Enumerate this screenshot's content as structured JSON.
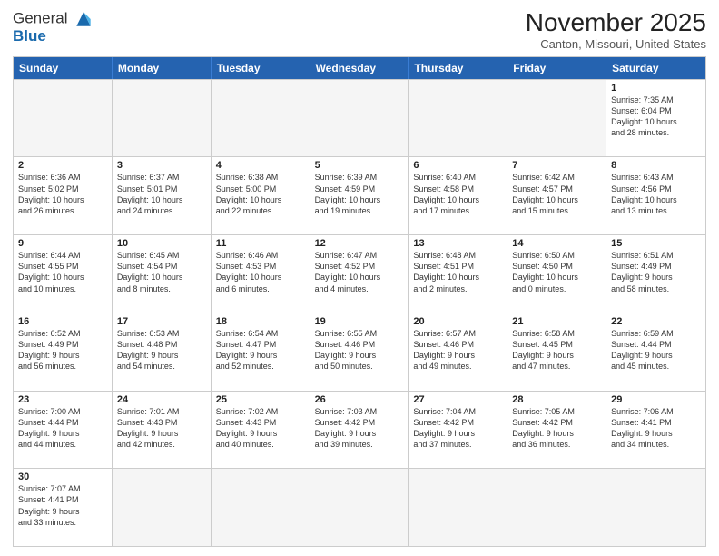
{
  "header": {
    "logo_line1": "General",
    "logo_line2": "Blue",
    "month": "November 2025",
    "location": "Canton, Missouri, United States"
  },
  "days_of_week": [
    "Sunday",
    "Monday",
    "Tuesday",
    "Wednesday",
    "Thursday",
    "Friday",
    "Saturday"
  ],
  "weeks": [
    [
      {
        "num": "",
        "info": "",
        "empty": true
      },
      {
        "num": "",
        "info": "",
        "empty": true
      },
      {
        "num": "",
        "info": "",
        "empty": true
      },
      {
        "num": "",
        "info": "",
        "empty": true
      },
      {
        "num": "",
        "info": "",
        "empty": true
      },
      {
        "num": "",
        "info": "",
        "empty": true
      },
      {
        "num": "1",
        "info": "Sunrise: 7:35 AM\nSunset: 6:04 PM\nDaylight: 10 hours\nand 28 minutes.",
        "empty": false
      }
    ],
    [
      {
        "num": "2",
        "info": "Sunrise: 6:36 AM\nSunset: 5:02 PM\nDaylight: 10 hours\nand 26 minutes.",
        "empty": false
      },
      {
        "num": "3",
        "info": "Sunrise: 6:37 AM\nSunset: 5:01 PM\nDaylight: 10 hours\nand 24 minutes.",
        "empty": false
      },
      {
        "num": "4",
        "info": "Sunrise: 6:38 AM\nSunset: 5:00 PM\nDaylight: 10 hours\nand 22 minutes.",
        "empty": false
      },
      {
        "num": "5",
        "info": "Sunrise: 6:39 AM\nSunset: 4:59 PM\nDaylight: 10 hours\nand 19 minutes.",
        "empty": false
      },
      {
        "num": "6",
        "info": "Sunrise: 6:40 AM\nSunset: 4:58 PM\nDaylight: 10 hours\nand 17 minutes.",
        "empty": false
      },
      {
        "num": "7",
        "info": "Sunrise: 6:42 AM\nSunset: 4:57 PM\nDaylight: 10 hours\nand 15 minutes.",
        "empty": false
      },
      {
        "num": "8",
        "info": "Sunrise: 6:43 AM\nSunset: 4:56 PM\nDaylight: 10 hours\nand 13 minutes.",
        "empty": false
      }
    ],
    [
      {
        "num": "9",
        "info": "Sunrise: 6:44 AM\nSunset: 4:55 PM\nDaylight: 10 hours\nand 10 minutes.",
        "empty": false
      },
      {
        "num": "10",
        "info": "Sunrise: 6:45 AM\nSunset: 4:54 PM\nDaylight: 10 hours\nand 8 minutes.",
        "empty": false
      },
      {
        "num": "11",
        "info": "Sunrise: 6:46 AM\nSunset: 4:53 PM\nDaylight: 10 hours\nand 6 minutes.",
        "empty": false
      },
      {
        "num": "12",
        "info": "Sunrise: 6:47 AM\nSunset: 4:52 PM\nDaylight: 10 hours\nand 4 minutes.",
        "empty": false
      },
      {
        "num": "13",
        "info": "Sunrise: 6:48 AM\nSunset: 4:51 PM\nDaylight: 10 hours\nand 2 minutes.",
        "empty": false
      },
      {
        "num": "14",
        "info": "Sunrise: 6:50 AM\nSunset: 4:50 PM\nDaylight: 10 hours\nand 0 minutes.",
        "empty": false
      },
      {
        "num": "15",
        "info": "Sunrise: 6:51 AM\nSunset: 4:49 PM\nDaylight: 9 hours\nand 58 minutes.",
        "empty": false
      }
    ],
    [
      {
        "num": "16",
        "info": "Sunrise: 6:52 AM\nSunset: 4:49 PM\nDaylight: 9 hours\nand 56 minutes.",
        "empty": false
      },
      {
        "num": "17",
        "info": "Sunrise: 6:53 AM\nSunset: 4:48 PM\nDaylight: 9 hours\nand 54 minutes.",
        "empty": false
      },
      {
        "num": "18",
        "info": "Sunrise: 6:54 AM\nSunset: 4:47 PM\nDaylight: 9 hours\nand 52 minutes.",
        "empty": false
      },
      {
        "num": "19",
        "info": "Sunrise: 6:55 AM\nSunset: 4:46 PM\nDaylight: 9 hours\nand 50 minutes.",
        "empty": false
      },
      {
        "num": "20",
        "info": "Sunrise: 6:57 AM\nSunset: 4:46 PM\nDaylight: 9 hours\nand 49 minutes.",
        "empty": false
      },
      {
        "num": "21",
        "info": "Sunrise: 6:58 AM\nSunset: 4:45 PM\nDaylight: 9 hours\nand 47 minutes.",
        "empty": false
      },
      {
        "num": "22",
        "info": "Sunrise: 6:59 AM\nSunset: 4:44 PM\nDaylight: 9 hours\nand 45 minutes.",
        "empty": false
      }
    ],
    [
      {
        "num": "23",
        "info": "Sunrise: 7:00 AM\nSunset: 4:44 PM\nDaylight: 9 hours\nand 44 minutes.",
        "empty": false
      },
      {
        "num": "24",
        "info": "Sunrise: 7:01 AM\nSunset: 4:43 PM\nDaylight: 9 hours\nand 42 minutes.",
        "empty": false
      },
      {
        "num": "25",
        "info": "Sunrise: 7:02 AM\nSunset: 4:43 PM\nDaylight: 9 hours\nand 40 minutes.",
        "empty": false
      },
      {
        "num": "26",
        "info": "Sunrise: 7:03 AM\nSunset: 4:42 PM\nDaylight: 9 hours\nand 39 minutes.",
        "empty": false
      },
      {
        "num": "27",
        "info": "Sunrise: 7:04 AM\nSunset: 4:42 PM\nDaylight: 9 hours\nand 37 minutes.",
        "empty": false
      },
      {
        "num": "28",
        "info": "Sunrise: 7:05 AM\nSunset: 4:42 PM\nDaylight: 9 hours\nand 36 minutes.",
        "empty": false
      },
      {
        "num": "29",
        "info": "Sunrise: 7:06 AM\nSunset: 4:41 PM\nDaylight: 9 hours\nand 34 minutes.",
        "empty": false
      }
    ],
    [
      {
        "num": "30",
        "info": "Sunrise: 7:07 AM\nSunset: 4:41 PM\nDaylight: 9 hours\nand 33 minutes.",
        "empty": false
      },
      {
        "num": "",
        "info": "",
        "empty": true
      },
      {
        "num": "",
        "info": "",
        "empty": true
      },
      {
        "num": "",
        "info": "",
        "empty": true
      },
      {
        "num": "",
        "info": "",
        "empty": true
      },
      {
        "num": "",
        "info": "",
        "empty": true
      },
      {
        "num": "",
        "info": "",
        "empty": true
      }
    ]
  ]
}
